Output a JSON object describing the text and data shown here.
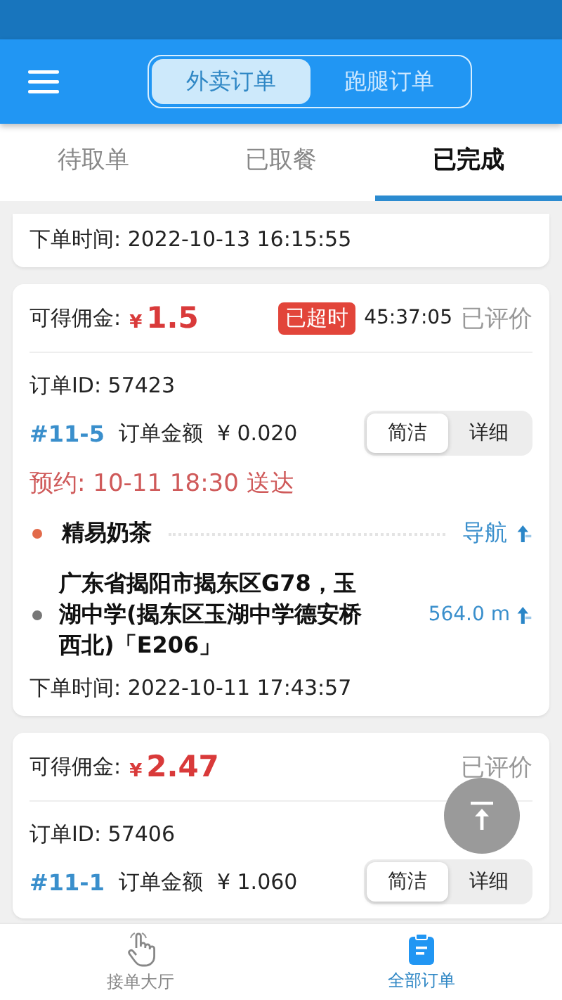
{
  "header": {
    "segments": [
      {
        "label": "外卖订单",
        "selected": true
      },
      {
        "label": "跑腿订单",
        "selected": false
      }
    ]
  },
  "tabs": [
    {
      "label": "待取单",
      "selected": false
    },
    {
      "label": "已取餐",
      "selected": false
    },
    {
      "label": "已完成",
      "selected": true
    }
  ],
  "orders": [
    {
      "order_time": "下单时间: 2022-10-13 16:15:55"
    },
    {
      "commission_label": "可得佣金:",
      "currency": "¥",
      "commission": "1.5",
      "badge": "已超时",
      "elapsed": "45:37:05",
      "review": "已评价",
      "order_id": "订单ID: 57423",
      "number": "#11-5",
      "amount_label": "订单金额",
      "amount": "¥ 0.020",
      "views": [
        {
          "label": "简洁",
          "selected": true
        },
        {
          "label": "详细",
          "selected": false
        }
      ],
      "reservation": "预约: 10-11  18:30 送达",
      "store": {
        "name": "精易奶茶",
        "action": "导航"
      },
      "address": {
        "text": "广东省揭阳市揭东区G78，玉湖中学(揭东区玉湖中学德安桥西北)「E206」",
        "distance": "564.0 m"
      },
      "order_time": "下单时间: 2022-10-11 17:43:57"
    },
    {
      "commission_label": "可得佣金:",
      "currency": "¥",
      "commission": "2.47",
      "review": "已评价",
      "order_id": "订单ID: 57406",
      "number": "#11-1",
      "amount_label": "订单金额",
      "amount": "¥ 1.060",
      "views": [
        {
          "label": "简洁",
          "selected": true
        },
        {
          "label": "详细",
          "selected": false
        }
      ]
    }
  ],
  "bottom_nav": [
    {
      "label": "接单大厅",
      "selected": false
    },
    {
      "label": "全部订单",
      "selected": true
    }
  ]
}
